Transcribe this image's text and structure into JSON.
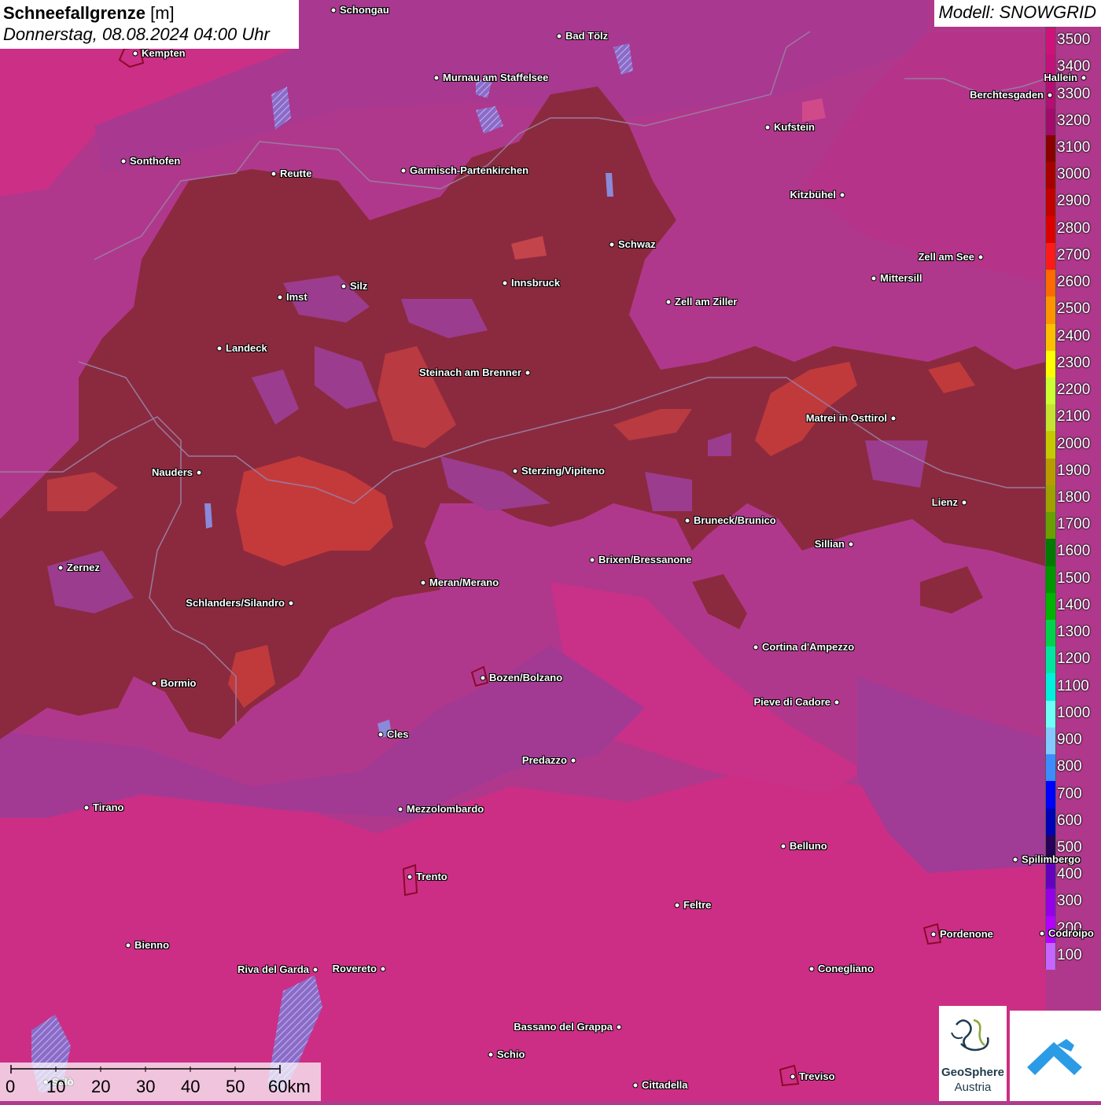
{
  "title": {
    "variable": "Schneefallgrenze",
    "unit": "[m]",
    "datetime": "Donnerstag, 08.08.2024 04:00 Uhr"
  },
  "model": "Modell: SNOWGRID",
  "legend": {
    "labels": [
      "3500",
      "3400",
      "3300",
      "3200",
      "3100",
      "3000",
      "2900",
      "2800",
      "2700",
      "2600",
      "2500",
      "2400",
      "2300",
      "2200",
      "2100",
      "2000",
      "1900",
      "1800",
      "1700",
      "1600",
      "1500",
      "1400",
      "1300",
      "1200",
      "1100",
      "1000",
      "900",
      "800",
      "700",
      "600",
      "500",
      "400",
      "300",
      "200",
      "100"
    ],
    "colors": [
      "#d0117c",
      "#c4107a",
      "#b20e73",
      "#a10b6c",
      "#8a0000",
      "#a80000",
      "#c30000",
      "#dd0000",
      "#ff1a1a",
      "#ff6a00",
      "#ff9400",
      "#ffbf00",
      "#ffff00",
      "#ccff33",
      "#c8e232",
      "#c8c800",
      "#b99b00",
      "#a0a000",
      "#6a9f00",
      "#007a00",
      "#009600",
      "#00b400",
      "#00d24b",
      "#00e6a0",
      "#00f0dc",
      "#70fff8",
      "#85c8ff",
      "#3c8cff",
      "#0000ff",
      "#0000b4",
      "#28005a",
      "#6400be",
      "#9600e6",
      "#b400ff",
      "#c864ff"
    ]
  },
  "cities": [
    {
      "name": "Schongau"
    },
    {
      "name": "Bad Tölz"
    },
    {
      "name": "Kempten"
    },
    {
      "name": "Murnau am Staffelsee"
    },
    {
      "name": "Hallein"
    },
    {
      "name": "Berchtesgaden"
    },
    {
      "name": "Kufstein"
    },
    {
      "name": "Sonthofen"
    },
    {
      "name": "Reutte"
    },
    {
      "name": "Garmisch-Partenkirchen"
    },
    {
      "name": "Kitzbühel"
    },
    {
      "name": "Schwaz"
    },
    {
      "name": "Zell am See"
    },
    {
      "name": "Innsbruck"
    },
    {
      "name": "Mittersill"
    },
    {
      "name": "Silz"
    },
    {
      "name": "Imst"
    },
    {
      "name": "Zell am Ziller"
    },
    {
      "name": "Landeck"
    },
    {
      "name": "Steinach am Brenner"
    },
    {
      "name": "Matrei in Osttirol"
    },
    {
      "name": "Nauders"
    },
    {
      "name": "Sterzing/Vipiteno"
    },
    {
      "name": "Lienz"
    },
    {
      "name": "Bruneck/Brunico"
    },
    {
      "name": "Sillian"
    },
    {
      "name": "Brixen/Bressanone"
    },
    {
      "name": "Zernez"
    },
    {
      "name": "Meran/Merano"
    },
    {
      "name": "Schlanders/Silandro"
    },
    {
      "name": "Cortina d'Ampezzo"
    },
    {
      "name": "Bozen/Bolzano"
    },
    {
      "name": "Bormio"
    },
    {
      "name": "Pieve di Cadore"
    },
    {
      "name": "Cles"
    },
    {
      "name": "Predazzo"
    },
    {
      "name": "Tirano"
    },
    {
      "name": "Mezzolombardo"
    },
    {
      "name": "Belluno"
    },
    {
      "name": "Spilimbergo"
    },
    {
      "name": "Trento"
    },
    {
      "name": "Feltre"
    },
    {
      "name": "Pordenone"
    },
    {
      "name": "Codroipo"
    },
    {
      "name": "Bienno"
    },
    {
      "name": "Riva del Garda"
    },
    {
      "name": "Rovereto"
    },
    {
      "name": "Conegliano"
    },
    {
      "name": "Bassano del Grappa"
    },
    {
      "name": "Schio"
    },
    {
      "name": "Salò"
    },
    {
      "name": "Treviso"
    },
    {
      "name": "Cittadella"
    }
  ],
  "scale_bar": {
    "ticks": [
      "0",
      "10",
      "20",
      "30",
      "40",
      "50",
      "60km"
    ]
  },
  "logos": {
    "geosphere_line1": "GeoSphere",
    "geosphere_line2": "Austria"
  }
}
